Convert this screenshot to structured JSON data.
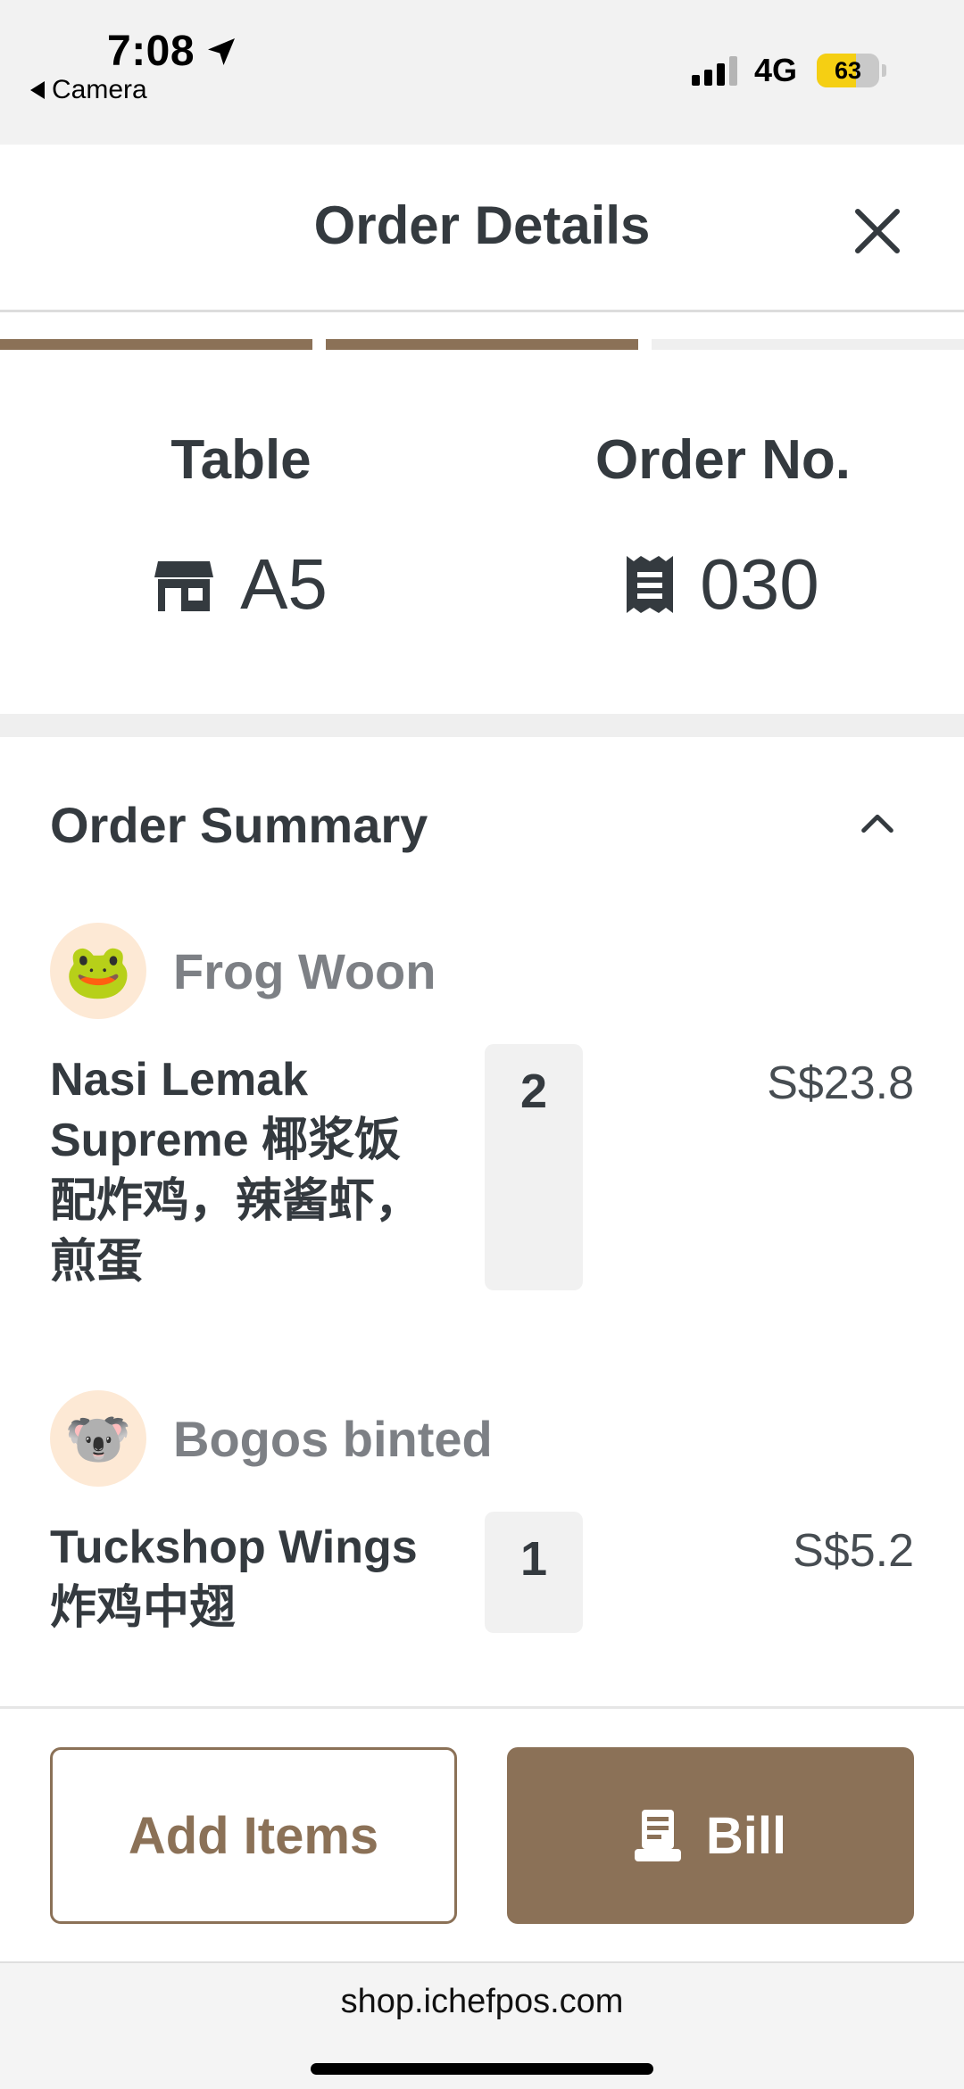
{
  "status_bar": {
    "time": "7:08",
    "back_label": "Camera",
    "network": "4G",
    "battery": "63",
    "battery_level": 0.63
  },
  "header": {
    "title": "Order Details"
  },
  "progress": {
    "steps_total": 3,
    "steps_completed": 2,
    "active_color": "#8b7157",
    "inactive_color": "#efefef"
  },
  "info": {
    "table_label": "Table",
    "table_value": "A5",
    "order_label": "Order No.",
    "order_value": "030"
  },
  "summary": {
    "title": "Order Summary",
    "groups": [
      {
        "avatar_emoji": "🐸",
        "name": "Frog Woon",
        "items": [
          {
            "name": "Nasi Lemak Supreme 椰浆饭配炸鸡，辣酱虾，煎蛋",
            "qty": "2",
            "price": "S$23.8"
          }
        ]
      },
      {
        "avatar_emoji": "🐨",
        "name": "Bogos binted",
        "items": [
          {
            "name": "Tuckshop Wings 炸鸡中翅",
            "qty": "1",
            "price": "S$5.2"
          }
        ]
      }
    ]
  },
  "actions": {
    "add_items_label": "Add Items",
    "bill_label": "Bill"
  },
  "browser": {
    "url": "shop.ichefpos.com"
  },
  "colors": {
    "accent": "#8b7157",
    "text_primary": "#343a3f",
    "text_muted": "#7d8085",
    "avatar_bg": "#fde9d5"
  }
}
